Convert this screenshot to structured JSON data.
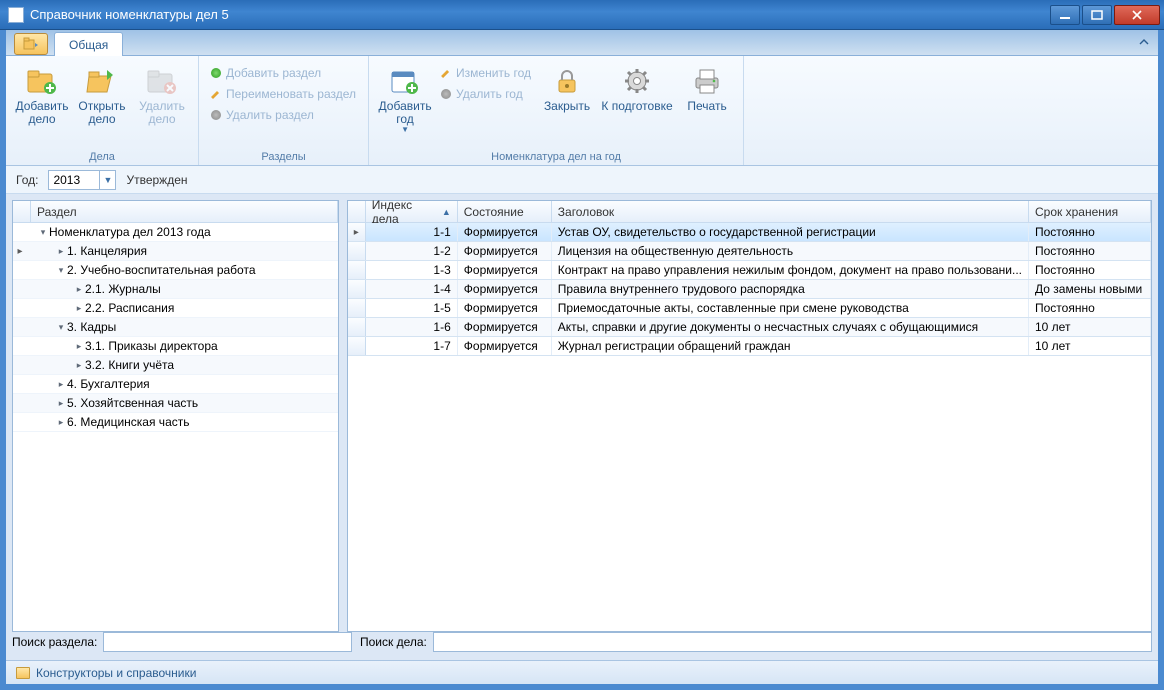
{
  "window": {
    "title": "Справочник номенклатуры дел 5"
  },
  "tabstrip": {
    "tab1": "Общая"
  },
  "ribbon": {
    "group_dela": {
      "label": "Дела",
      "add_delo": "Добавить дело",
      "open_delo": "Открыть дело",
      "del_delo": "Удалить дело"
    },
    "group_razdely": {
      "label": "Разделы",
      "add": "Добавить раздел",
      "rename": "Переименовать раздел",
      "del": "Удалить раздел"
    },
    "group_nomen": {
      "label": "Номенклатура дел на год",
      "add_year": "Добавить год",
      "edit_year": "Изменить год",
      "del_year": "Удалить год",
      "lock": "Закрыть",
      "prepare": "К подготовке",
      "print": "Печать"
    }
  },
  "year_row": {
    "label": "Год:",
    "value": "2013",
    "status": "Утвержден"
  },
  "tree": {
    "header": "Раздел",
    "root": "Номенклатура дел 2013 года",
    "nodes": [
      {
        "label": "1. Канцелярия",
        "depth": 1,
        "expanded": null
      },
      {
        "label": "2. Учебно-воспитательная работа",
        "depth": 1,
        "expanded": true
      },
      {
        "label": "2.1. Журналы",
        "depth": 2,
        "expanded": null
      },
      {
        "label": "2.2. Расписания",
        "depth": 2,
        "expanded": null
      },
      {
        "label": "3. Кадры",
        "depth": 1,
        "expanded": true
      },
      {
        "label": "3.1. Приказы директора",
        "depth": 2,
        "expanded": null
      },
      {
        "label": "3.2. Книги учёта",
        "depth": 2,
        "expanded": null
      },
      {
        "label": "4. Бухгалтерия",
        "depth": 1,
        "expanded": null
      },
      {
        "label": "5. Хозяйтсвенная часть",
        "depth": 1,
        "expanded": null
      },
      {
        "label": "6. Медицинская часть",
        "depth": 1,
        "expanded": null
      }
    ],
    "search_label": "Поиск раздела:"
  },
  "grid": {
    "columns": {
      "index": "Индекс дела",
      "state": "Состояние",
      "title": "Заголовок",
      "storage": "Срок хранения"
    },
    "rows": [
      {
        "idx": "1-1",
        "state": "Формируется",
        "title": "Устав ОУ, свидетельство о государственной регистрации",
        "storage": "Постоянно",
        "selected": true
      },
      {
        "idx": "1-2",
        "state": "Формируется",
        "title": "Лицензия на общественную деятельность",
        "storage": "Постоянно"
      },
      {
        "idx": "1-3",
        "state": "Формируется",
        "title": "Контракт на право управления нежилым фондом, документ на право пользовани...",
        "storage": "Постоянно"
      },
      {
        "idx": "1-4",
        "state": "Формируется",
        "title": "Правила внутреннего трудового распорядка",
        "storage": "До замены новыми"
      },
      {
        "idx": "1-5",
        "state": "Формируется",
        "title": "Приемосдаточные акты, составленные при смене руководства",
        "storage": "Постоянно"
      },
      {
        "idx": "1-6",
        "state": "Формируется",
        "title": "Акты, справки и другие документы о несчастных случаях с обущающимися",
        "storage": "10 лет"
      },
      {
        "idx": "1-7",
        "state": "Формируется",
        "title": "Журнал регистрации обращений граждан",
        "storage": "10 лет"
      }
    ],
    "search_label": "Поиск дела:"
  },
  "statusbar": {
    "text": "Конструкторы и справочники"
  }
}
